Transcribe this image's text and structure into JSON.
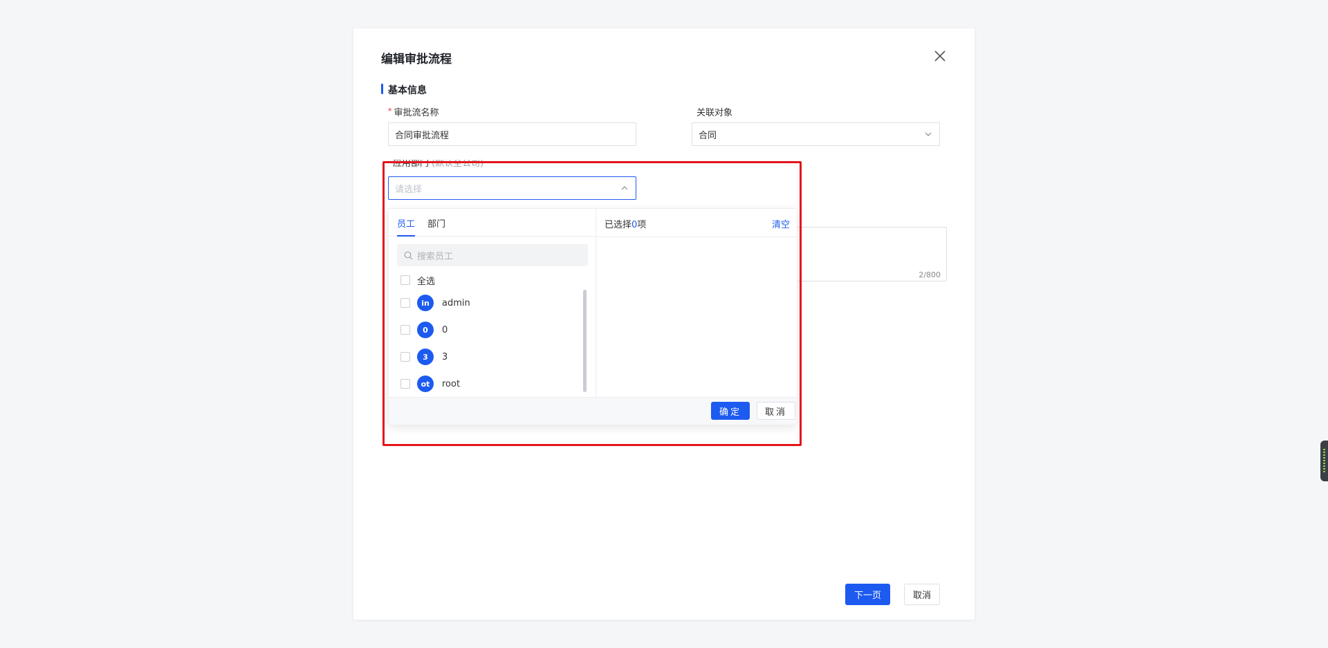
{
  "modal": {
    "title": "编辑审批流程",
    "section_title": "基本信息"
  },
  "form": {
    "name_label": "审批流名称",
    "name_required_mark": "*",
    "name_value": "合同审批流程",
    "object_label": "关联对象",
    "object_value": "合同",
    "dept_label": "应用部门",
    "dept_hint": "(默认全公司)",
    "dept_placeholder": "请选择",
    "textarea_count": "2/800"
  },
  "picker": {
    "tabs": [
      "员工",
      "部门"
    ],
    "active_tab": "员工",
    "search_placeholder": "搜索员工",
    "select_all_label": "全选",
    "employees": [
      {
        "avatar": "in",
        "name": "admin"
      },
      {
        "avatar": "0",
        "name": "0"
      },
      {
        "avatar": "3",
        "name": "3"
      },
      {
        "avatar": "ot",
        "name": "root"
      }
    ],
    "selected_prefix": "已选择",
    "selected_count": "0",
    "selected_suffix": "项",
    "clear_label": "清空",
    "confirm_label": "确定",
    "cancel_label": "取消"
  },
  "footer": {
    "next_label": "下一页",
    "cancel_label": "取消"
  },
  "colors": {
    "accent": "#1d5af0",
    "highlight": "#e3141b"
  }
}
